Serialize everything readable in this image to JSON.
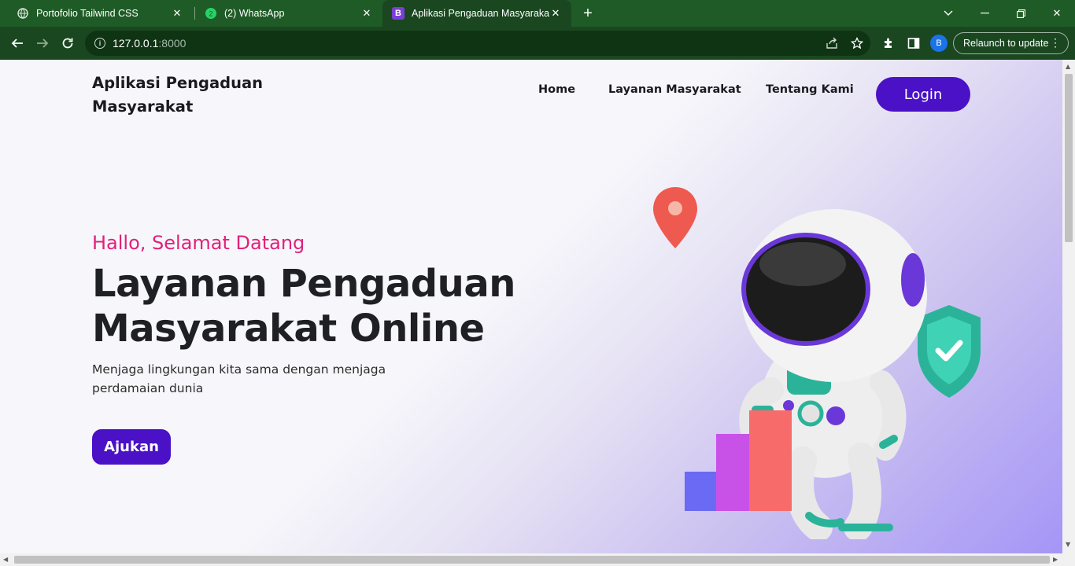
{
  "browser": {
    "tabs": [
      {
        "title": "Portofolio Tailwind CSS",
        "icon": "globe-icon",
        "active": false
      },
      {
        "title": "(2) WhatsApp",
        "icon": "whatsapp-icon",
        "badge": "2",
        "active": false
      },
      {
        "title": "Aplikasi Pengaduan Masyarakat",
        "icon": "bootstrap-icon",
        "favicon_letter": "B",
        "active": true
      }
    ],
    "url_host": "127.0.0.1",
    "url_port": ":8000",
    "profile_initial": "B",
    "relaunch_label": "Relaunch to update"
  },
  "header": {
    "brand": "Aplikasi Pengaduan Masyarakat",
    "nav": [
      "Home",
      "Layanan Masyarakat",
      "Tentang Kami"
    ],
    "login_label": "Login"
  },
  "hero": {
    "greeting": "Hallo, Selamat Datang",
    "headline": "Layanan Pengaduan Masyarakat Online",
    "subtext": "Menjaga lingkungan kita sama dengan menjaga perdamaian dunia",
    "cta_label": "Ajukan"
  },
  "colors": {
    "accent": "#4a11c6",
    "greeting": "#e0217a",
    "chrome_dark": "#1a4720",
    "chrome_tabbar": "#1f5b26"
  }
}
